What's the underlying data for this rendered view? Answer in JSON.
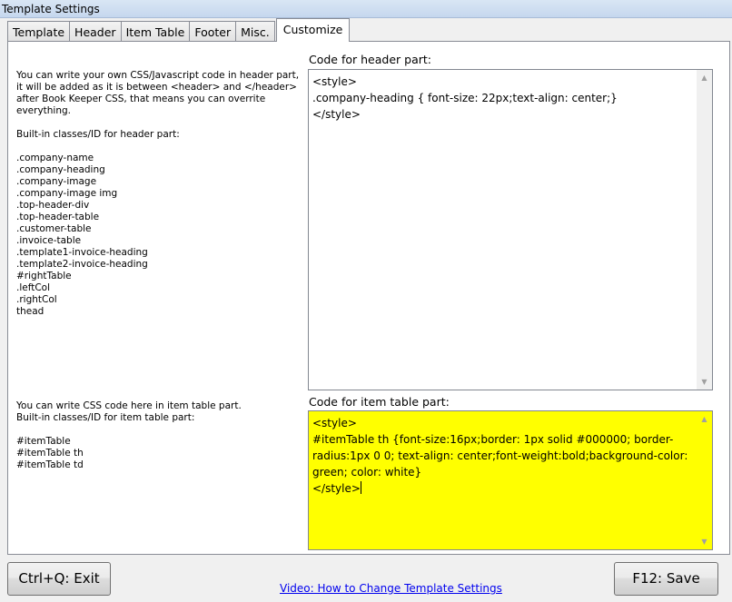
{
  "window": {
    "title": "Template Settings"
  },
  "tabs": [
    {
      "label": "Template"
    },
    {
      "label": "Header"
    },
    {
      "label": "Item Table"
    },
    {
      "label": "Footer"
    },
    {
      "label": "Misc."
    },
    {
      "label": "Customize"
    }
  ],
  "active_tab": "Customize",
  "header_help": "You can write your own CSS/Javascript code in header part,\nit will be added as it is between <header> and </header>\nafter Book Keeper CSS, that means you can overrite\neverything.\n\nBuilt-in classes/ID for header part:\n\n.company-name\n.company-heading\n.company-image\n.company-image img\n.top-header-div\n.top-header-table\n.customer-table\n.invoice-table\n.template1-invoice-heading\n.template2-invoice-heading\n#rightTable\n.leftCol\n.rightCol\nthead",
  "item_help": "You can write CSS code here in item table part.\nBuilt-in classes/ID for item table part:\n\n#itemTable\n#itemTable th\n#itemTable td",
  "header_code": {
    "label": "Code for header part:",
    "value": "<style>\n.company-heading { font-size: 22px;text-align: center;}\n</style>"
  },
  "item_code": {
    "label": "Code for item table part:",
    "value": "<style>\n#itemTable th {font-size:16px;border: 1px solid #000000; border-radius:1px 0 0; text-align: center;font-weight:bold;background-color: green; color: white}\n</style>",
    "background": "#ffff00"
  },
  "buttons": {
    "exit": "Ctrl+Q: Exit",
    "save": "F12: Save"
  },
  "video_link": "Video: How to Change Template Settings"
}
